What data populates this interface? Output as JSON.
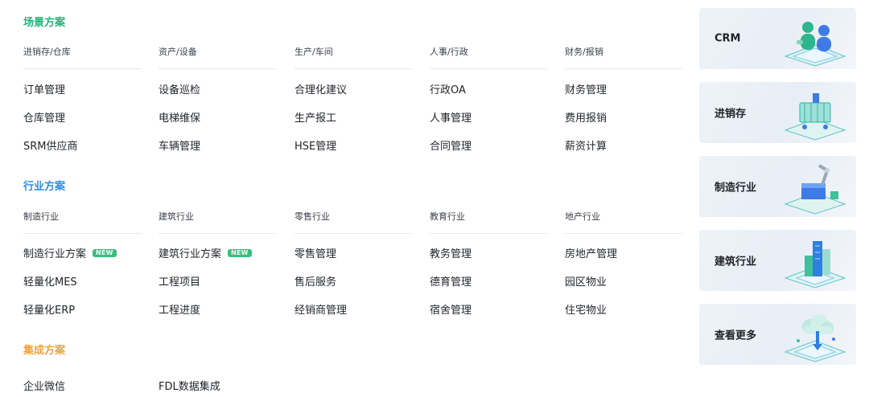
{
  "sections": [
    {
      "title": "场景方案",
      "color": "#1fb377",
      "columns": [
        {
          "category": "进销存/仓库",
          "items": [
            {
              "label": "订单管理"
            },
            {
              "label": "仓库管理"
            },
            {
              "label": "SRM供应商"
            }
          ]
        },
        {
          "category": "资产/设备",
          "items": [
            {
              "label": "设备巡检"
            },
            {
              "label": "电梯维保"
            },
            {
              "label": "车辆管理"
            }
          ]
        },
        {
          "category": "生产/车间",
          "items": [
            {
              "label": "合理化建议"
            },
            {
              "label": "生产报工"
            },
            {
              "label": "HSE管理"
            }
          ]
        },
        {
          "category": "人事/行政",
          "items": [
            {
              "label": "行政OA"
            },
            {
              "label": "人事管理"
            },
            {
              "label": "合同管理"
            }
          ]
        },
        {
          "category": "财务/报销",
          "items": [
            {
              "label": "财务管理"
            },
            {
              "label": "费用报销"
            },
            {
              "label": "薪资计算"
            }
          ]
        }
      ]
    },
    {
      "title": "行业方案",
      "color": "#2e8be8",
      "columns": [
        {
          "category": "制造行业",
          "items": [
            {
              "label": "制造行业方案",
              "badge": "NEW"
            },
            {
              "label": "轻量化MES"
            },
            {
              "label": "轻量化ERP"
            }
          ]
        },
        {
          "category": "建筑行业",
          "items": [
            {
              "label": "建筑行业方案",
              "badge": "NEW"
            },
            {
              "label": "工程项目"
            },
            {
              "label": "工程进度"
            }
          ]
        },
        {
          "category": "零售行业",
          "items": [
            {
              "label": "零售管理"
            },
            {
              "label": "售后服务"
            },
            {
              "label": "经销商管理"
            }
          ]
        },
        {
          "category": "教育行业",
          "items": [
            {
              "label": "教务管理"
            },
            {
              "label": "德育管理"
            },
            {
              "label": "宿舍管理"
            }
          ]
        },
        {
          "category": "地产行业",
          "items": [
            {
              "label": "房地产管理"
            },
            {
              "label": "园区物业"
            },
            {
              "label": "住宅物业"
            }
          ]
        }
      ]
    },
    {
      "title": "集成方案",
      "color": "#f0a23a",
      "items": [
        {
          "label": "企业微信"
        },
        {
          "label": "FDL数据集成"
        }
      ]
    }
  ],
  "cards": [
    {
      "label": "CRM",
      "icon": "crm-people-icon"
    },
    {
      "label": "进销存",
      "icon": "shopping-cart-icon"
    },
    {
      "label": "制造行业",
      "icon": "robot-arm-icon"
    },
    {
      "label": "建筑行业",
      "icon": "buildings-icon"
    },
    {
      "label": "查看更多",
      "icon": "cloud-more-icon"
    }
  ]
}
